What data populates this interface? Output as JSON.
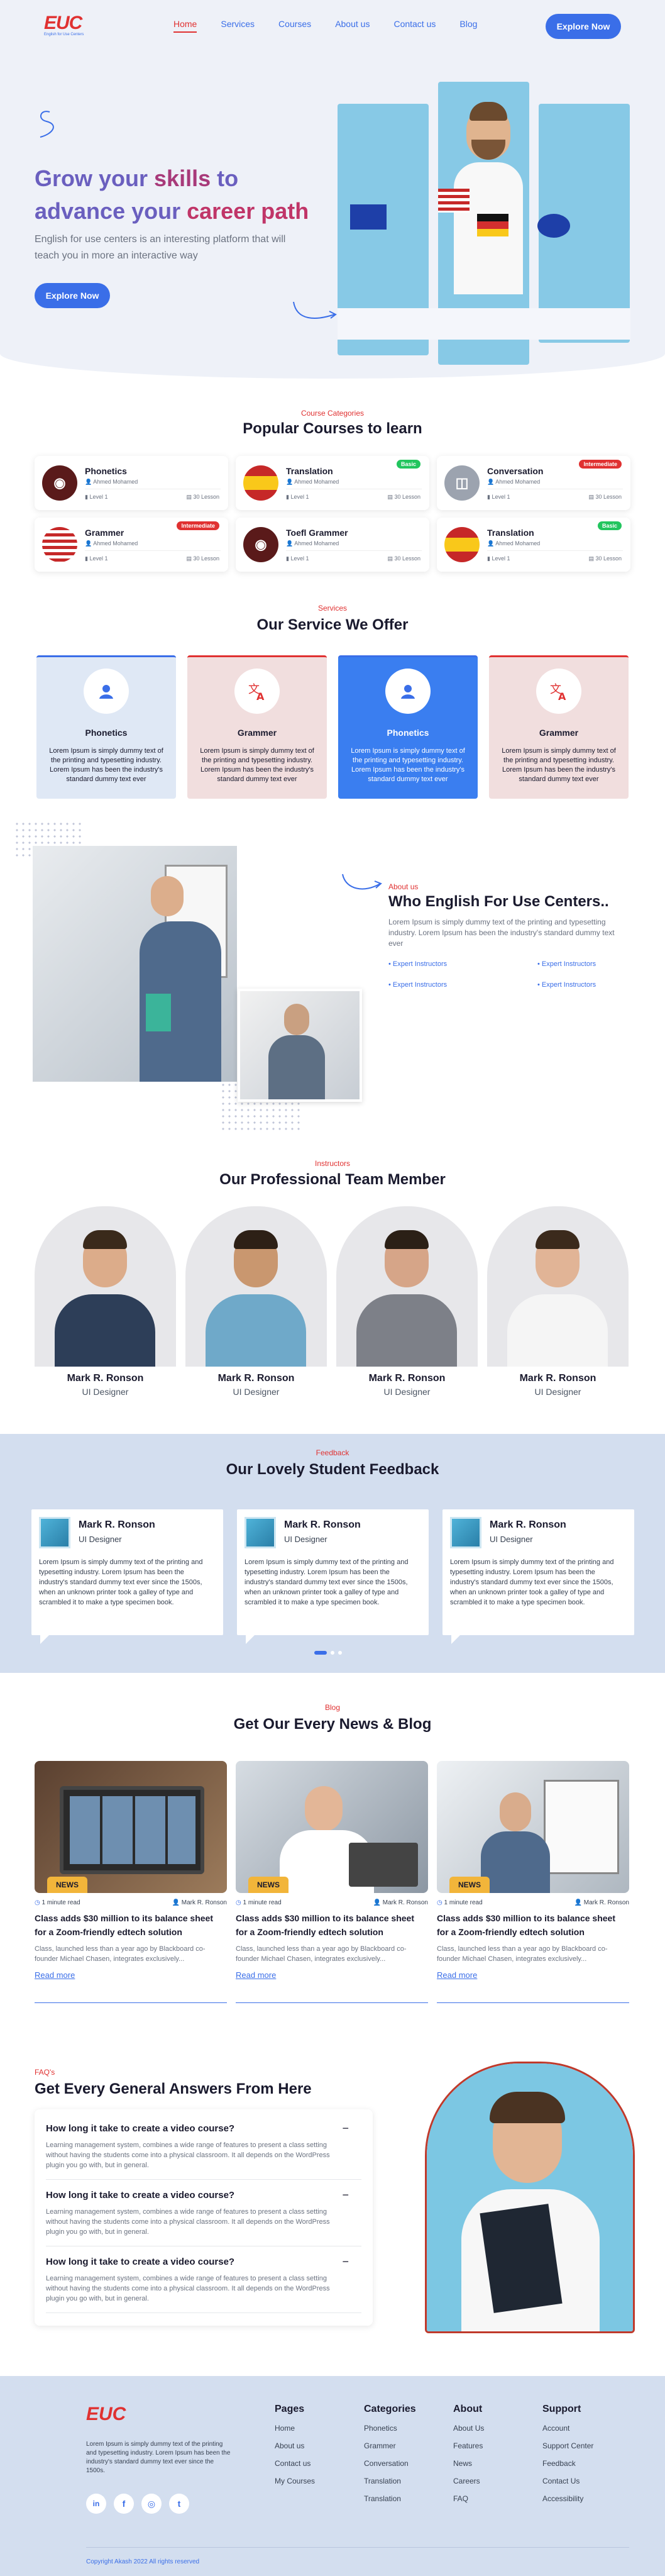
{
  "nav": {
    "logo": "EUC",
    "logo_sub": "English for Use Centers",
    "items": [
      "Home",
      "Services",
      "Courses",
      "About us",
      "Contact us",
      "Blog"
    ],
    "cta": "Explore Now"
  },
  "hero": {
    "title_1": "Grow your ",
    "title_hl1": "skills",
    "title_2": " to",
    "title_3": "advance your ",
    "title_hl2": "career path",
    "desc": "English for use centers is an interesting platform that will teach you in more an interactive way",
    "cta": "Explore Now"
  },
  "courses": {
    "label": "Course Categories",
    "title": "Popular Courses to learn",
    "items": [
      {
        "name": "Phonetics",
        "author": "Ahmed Mohamed",
        "level": "Level 1",
        "lessons": "30 Lesson",
        "badge": "",
        "badge_color": "",
        "flag": "speaker"
      },
      {
        "name": "Translation",
        "author": "Ahmed Mohamed",
        "level": "Level 1",
        "lessons": "30 Lesson",
        "badge": "Basic",
        "badge_color": "#22c55e",
        "flag": "es"
      },
      {
        "name": "Conversation",
        "author": "Ahmed Mohamed",
        "level": "Level 1",
        "lessons": "30 Lesson",
        "badge": "Intermediate",
        "badge_color": "#e03131",
        "flag": "chat"
      },
      {
        "name": "Grammer",
        "author": "Ahmed Mohamed",
        "level": "Level 1",
        "lessons": "30 Lesson",
        "badge": "Intermediate",
        "badge_color": "#e03131",
        "flag": "us"
      },
      {
        "name": "Toefl Grammer",
        "author": "Ahmed Mohamed",
        "level": "Level 1",
        "lessons": "30 Lesson",
        "badge": "",
        "badge_color": "",
        "flag": "speaker"
      },
      {
        "name": "Translation",
        "author": "Ahmed Mohamed",
        "level": "Level 1",
        "lessons": "30 Lesson",
        "badge": "Basic",
        "badge_color": "#22c55e",
        "flag": "es"
      }
    ]
  },
  "services": {
    "label": "Services",
    "title": "Our Service We Offer",
    "items": [
      {
        "name": "Phonetics",
        "desc": "Lorem Ipsum is simply dummy text of the printing and typesetting industry. Lorem Ipsum has been the industry's standard dummy text ever",
        "style": "light-blue"
      },
      {
        "name": "Grammer",
        "desc": "Lorem Ipsum is simply dummy text of the printing and typesetting industry. Lorem Ipsum has been the industry's standard dummy text ever",
        "style": "light-red"
      },
      {
        "name": "Phonetics",
        "desc": "Lorem Ipsum is simply dummy text of the printing and typesetting industry. Lorem Ipsum has been the industry's standard dummy text ever",
        "style": "blue"
      },
      {
        "name": "Grammer",
        "desc": "Lorem Ipsum is simply dummy text of the printing and typesetting industry. Lorem Ipsum has been the industry's standard dummy text ever",
        "style": "light-red"
      }
    ]
  },
  "about": {
    "label": "About us",
    "title": "Who English For Use Centers..",
    "desc": "Lorem Ipsum is simply dummy text of the printing and typesetting industry. Lorem Ipsum has been the industry's standard dummy text ever",
    "points": [
      "Expert Instructors",
      "Expert Instructors",
      "Expert Instructors",
      "Expert Instructors"
    ]
  },
  "team": {
    "label": "Instructors",
    "title": "Our Professional Team Member",
    "members": [
      {
        "name": "Mark R. Ronson",
        "role": "UI Designer"
      },
      {
        "name": "Mark R. Ronson",
        "role": "UI Designer"
      },
      {
        "name": "Mark R. Ronson",
        "role": "UI Designer"
      },
      {
        "name": "Mark R. Ronson",
        "role": "UI Designer"
      }
    ]
  },
  "feedback": {
    "label": "Feedback",
    "title": "Our Lovely Student Feedback",
    "items": [
      {
        "name": "Mark R. Ronson",
        "role": "UI Designer",
        "text": "Lorem Ipsum is simply dummy text of the printing and typesetting industry. Lorem Ipsum has been the industry's standard dummy text ever since the 1500s, when an unknown printer took a galley of type and scrambled it to make a type specimen book."
      },
      {
        "name": "Mark R. Ronson",
        "role": "UI Designer",
        "text": "Lorem Ipsum is simply dummy text of the printing and typesetting industry. Lorem Ipsum has been the industry's standard dummy text ever since the 1500s, when an unknown printer took a galley of type and scrambled it to make a type specimen book."
      },
      {
        "name": "Mark R. Ronson",
        "role": "UI Designer",
        "text": "Lorem Ipsum is simply dummy text of the printing and typesetting industry. Lorem Ipsum has been the industry's standard dummy text ever since the 1500s, when an unknown printer took a galley of type and scrambled it to make a type specimen book."
      }
    ]
  },
  "blog": {
    "label": "Blog",
    "title": "Get Our Every News & Blog",
    "posts": [
      {
        "tag": "NEWS",
        "read": "1 minute read",
        "author": "Mark R. Ronson",
        "title": "Class adds $30 million to its balance sheet for a Zoom-friendly edtech solution",
        "excerpt": "Class, launched less than a year ago by Blackboard co-founder Michael Chasen, integrates exclusively...",
        "more": "Read more"
      },
      {
        "tag": "NEWS",
        "read": "1 minute read",
        "author": "Mark R. Ronson",
        "title": "Class adds $30 million to its balance sheet for a Zoom-friendly edtech solution",
        "excerpt": "Class, launched less than a year ago by Blackboard co-founder Michael Chasen, integrates exclusively...",
        "more": "Read more"
      },
      {
        "tag": "NEWS",
        "read": "1 minute read",
        "author": "Mark R. Ronson",
        "title": "Class adds $30 million to its balance sheet for a Zoom-friendly edtech solution",
        "excerpt": "Class, launched less than a year ago by Blackboard co-founder Michael Chasen, integrates exclusively...",
        "more": "Read more"
      }
    ]
  },
  "faq": {
    "label": "FAQ's",
    "title": "Get Every General Answers From Here",
    "items": [
      {
        "q": "How long it take to create a video course?",
        "a": "Learning management system, combines a wide range of features to present a class setting without having the students come into a physical classroom. It all depends on the WordPress plugin you go with, but in general.",
        "toggle": "−"
      },
      {
        "q": "How long it take to create a video course?",
        "a": "Learning management system, combines a wide range of features to present a class setting without having the students come into a physical classroom. It all depends on the WordPress plugin you go with, but in general.",
        "toggle": "−"
      },
      {
        "q": "How long it take to create a video course?",
        "a": "Learning management system, combines a wide range of features to present a class setting without having the students come into a physical classroom. It all depends on the WordPress plugin you go with, but in general.",
        "toggle": "−"
      }
    ]
  },
  "footer": {
    "logo": "EUC",
    "desc": "Lorem Ipsum is simply dummy text of the printing and typesetting industry. Lorem Ipsum has been the industry's standard dummy text ever since the 1500s.",
    "social": [
      "in",
      "f",
      "◎",
      "t"
    ],
    "cols": [
      {
        "title": "Pages",
        "links": [
          "Home",
          "About us",
          "Contact us",
          "My Courses"
        ]
      },
      {
        "title": "Categories",
        "links": [
          "Phonetics",
          "Grammer",
          "Conversation",
          "Translation",
          "Translation"
        ]
      },
      {
        "title": "About",
        "links": [
          "About Us",
          "Features",
          "News",
          "Careers",
          "FAQ"
        ]
      },
      {
        "title": "Support",
        "links": [
          "Account",
          "Support Center",
          "Feedback",
          "Contact Us",
          "Accessibility"
        ]
      }
    ],
    "copyright": "Copyright Akash 2022 All rights reserved"
  },
  "colors": {
    "accent": "#3a6ee8",
    "red": "#e03131",
    "hero_bg": "#eef1f8",
    "band_bg": "#d3deef",
    "photo_bg": "#87c9e6"
  }
}
